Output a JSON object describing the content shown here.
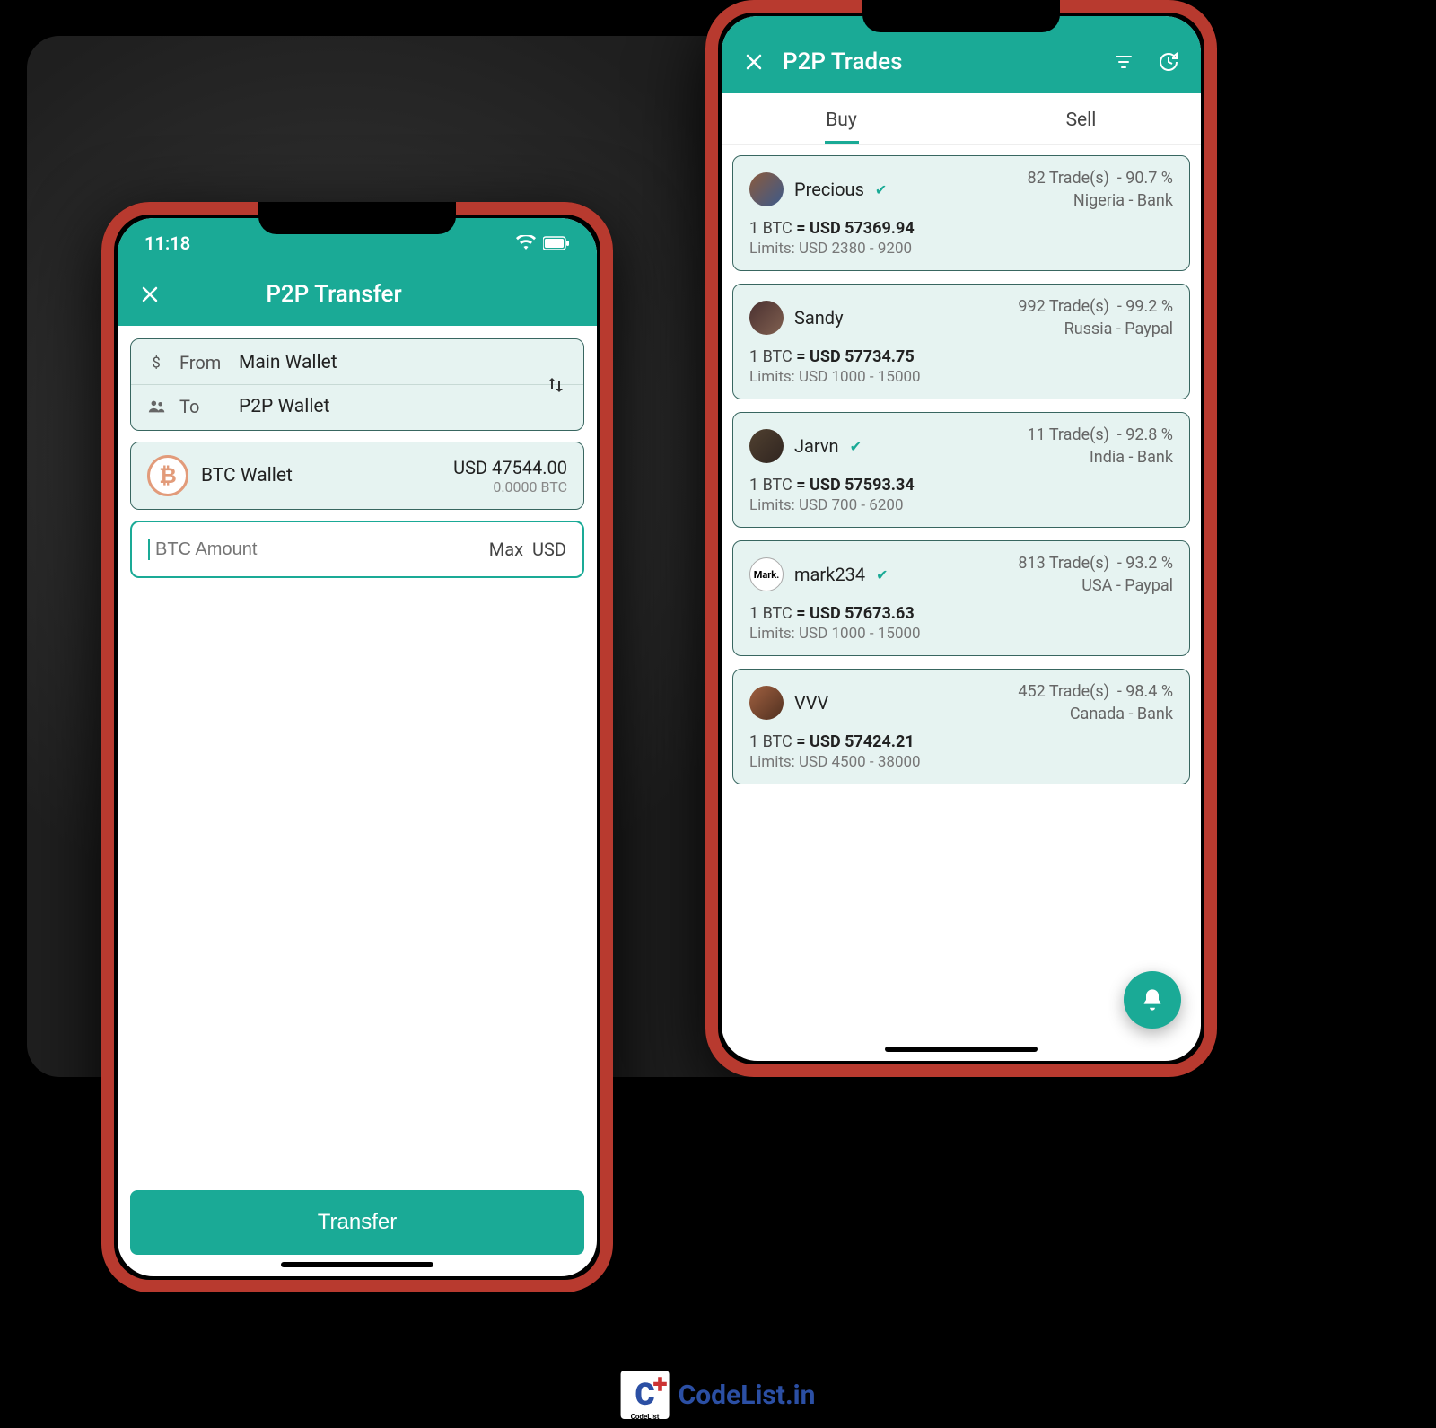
{
  "colors": {
    "accent": "#1aaa96",
    "card_bg": "#e6f3f1",
    "card_border": "#386660"
  },
  "status": {
    "time": "11:18"
  },
  "transfer": {
    "title": "P2P Transfer",
    "from_label": "From",
    "from_value": "Main Wallet",
    "to_label": "To",
    "to_value": "P2P Wallet",
    "wallet_name": "BTC Wallet",
    "wallet_usd": "USD 47544.00",
    "wallet_btc": "0.0000 BTC",
    "amount_placeholder": "BTC Amount",
    "max_label": "Max",
    "usd_label": "USD",
    "button": "Transfer"
  },
  "trades": {
    "title": "P2P Trades",
    "tabs": {
      "buy": "Buy",
      "sell": "Sell"
    },
    "unit": "1 BTC",
    "equals": "= USD",
    "limits_label": "Limits: USD",
    "list": [
      {
        "name": "Precious",
        "verified": true,
        "rate": "57369.94",
        "limits": "2380 - 9200",
        "trades": "82 Trade(s)",
        "pct": "90.7 %",
        "loc": "Nigeria - Bank",
        "av": "av1",
        "initial": ""
      },
      {
        "name": "Sandy",
        "verified": false,
        "rate": "57734.75",
        "limits": "1000 - 15000",
        "trades": "992 Trade(s)",
        "pct": "99.2 %",
        "loc": "Russia - Paypal",
        "av": "av2",
        "initial": ""
      },
      {
        "name": "Jarvn",
        "verified": true,
        "rate": "57593.34",
        "limits": "700 - 6200",
        "trades": "11 Trade(s)",
        "pct": "92.8 %",
        "loc": "India - Bank",
        "av": "av3",
        "initial": ""
      },
      {
        "name": "mark234",
        "verified": true,
        "rate": "57673.63",
        "limits": "1000 - 15000",
        "trades": "813 Trade(s)",
        "pct": "93.2 %",
        "loc": "USA - Paypal",
        "av": "av4",
        "initial": "Mark."
      },
      {
        "name": "VVV",
        "verified": false,
        "rate": "57424.21",
        "limits": "4500 - 38000",
        "trades": "452 Trade(s)",
        "pct": "98.4 %",
        "loc": "Canada - Bank",
        "av": "av5",
        "initial": ""
      }
    ]
  },
  "footer": {
    "brand": "CodeList.in"
  }
}
